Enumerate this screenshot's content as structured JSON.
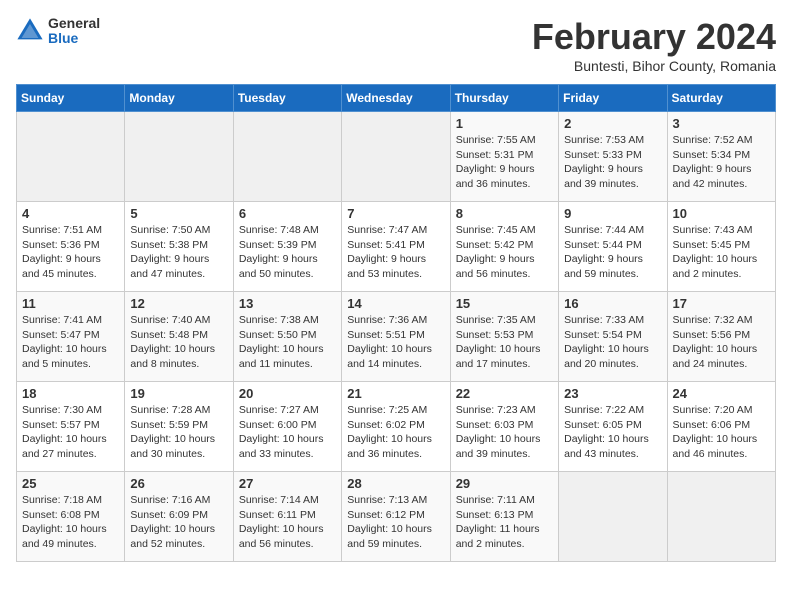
{
  "logo": {
    "general": "General",
    "blue": "Blue"
  },
  "title": {
    "month_year": "February 2024",
    "location": "Buntesti, Bihor County, Romania"
  },
  "headers": [
    "Sunday",
    "Monday",
    "Tuesday",
    "Wednesday",
    "Thursday",
    "Friday",
    "Saturday"
  ],
  "weeks": [
    [
      {
        "day": "",
        "content": ""
      },
      {
        "day": "",
        "content": ""
      },
      {
        "day": "",
        "content": ""
      },
      {
        "day": "",
        "content": ""
      },
      {
        "day": "1",
        "content": "Sunrise: 7:55 AM\nSunset: 5:31 PM\nDaylight: 9 hours and 36 minutes."
      },
      {
        "day": "2",
        "content": "Sunrise: 7:53 AM\nSunset: 5:33 PM\nDaylight: 9 hours and 39 minutes."
      },
      {
        "day": "3",
        "content": "Sunrise: 7:52 AM\nSunset: 5:34 PM\nDaylight: 9 hours and 42 minutes."
      }
    ],
    [
      {
        "day": "4",
        "content": "Sunrise: 7:51 AM\nSunset: 5:36 PM\nDaylight: 9 hours and 45 minutes."
      },
      {
        "day": "5",
        "content": "Sunrise: 7:50 AM\nSunset: 5:38 PM\nDaylight: 9 hours and 47 minutes."
      },
      {
        "day": "6",
        "content": "Sunrise: 7:48 AM\nSunset: 5:39 PM\nDaylight: 9 hours and 50 minutes."
      },
      {
        "day": "7",
        "content": "Sunrise: 7:47 AM\nSunset: 5:41 PM\nDaylight: 9 hours and 53 minutes."
      },
      {
        "day": "8",
        "content": "Sunrise: 7:45 AM\nSunset: 5:42 PM\nDaylight: 9 hours and 56 minutes."
      },
      {
        "day": "9",
        "content": "Sunrise: 7:44 AM\nSunset: 5:44 PM\nDaylight: 9 hours and 59 minutes."
      },
      {
        "day": "10",
        "content": "Sunrise: 7:43 AM\nSunset: 5:45 PM\nDaylight: 10 hours and 2 minutes."
      }
    ],
    [
      {
        "day": "11",
        "content": "Sunrise: 7:41 AM\nSunset: 5:47 PM\nDaylight: 10 hours and 5 minutes."
      },
      {
        "day": "12",
        "content": "Sunrise: 7:40 AM\nSunset: 5:48 PM\nDaylight: 10 hours and 8 minutes."
      },
      {
        "day": "13",
        "content": "Sunrise: 7:38 AM\nSunset: 5:50 PM\nDaylight: 10 hours and 11 minutes."
      },
      {
        "day": "14",
        "content": "Sunrise: 7:36 AM\nSunset: 5:51 PM\nDaylight: 10 hours and 14 minutes."
      },
      {
        "day": "15",
        "content": "Sunrise: 7:35 AM\nSunset: 5:53 PM\nDaylight: 10 hours and 17 minutes."
      },
      {
        "day": "16",
        "content": "Sunrise: 7:33 AM\nSunset: 5:54 PM\nDaylight: 10 hours and 20 minutes."
      },
      {
        "day": "17",
        "content": "Sunrise: 7:32 AM\nSunset: 5:56 PM\nDaylight: 10 hours and 24 minutes."
      }
    ],
    [
      {
        "day": "18",
        "content": "Sunrise: 7:30 AM\nSunset: 5:57 PM\nDaylight: 10 hours and 27 minutes."
      },
      {
        "day": "19",
        "content": "Sunrise: 7:28 AM\nSunset: 5:59 PM\nDaylight: 10 hours and 30 minutes."
      },
      {
        "day": "20",
        "content": "Sunrise: 7:27 AM\nSunset: 6:00 PM\nDaylight: 10 hours and 33 minutes."
      },
      {
        "day": "21",
        "content": "Sunrise: 7:25 AM\nSunset: 6:02 PM\nDaylight: 10 hours and 36 minutes."
      },
      {
        "day": "22",
        "content": "Sunrise: 7:23 AM\nSunset: 6:03 PM\nDaylight: 10 hours and 39 minutes."
      },
      {
        "day": "23",
        "content": "Sunrise: 7:22 AM\nSunset: 6:05 PM\nDaylight: 10 hours and 43 minutes."
      },
      {
        "day": "24",
        "content": "Sunrise: 7:20 AM\nSunset: 6:06 PM\nDaylight: 10 hours and 46 minutes."
      }
    ],
    [
      {
        "day": "25",
        "content": "Sunrise: 7:18 AM\nSunset: 6:08 PM\nDaylight: 10 hours and 49 minutes."
      },
      {
        "day": "26",
        "content": "Sunrise: 7:16 AM\nSunset: 6:09 PM\nDaylight: 10 hours and 52 minutes."
      },
      {
        "day": "27",
        "content": "Sunrise: 7:14 AM\nSunset: 6:11 PM\nDaylight: 10 hours and 56 minutes."
      },
      {
        "day": "28",
        "content": "Sunrise: 7:13 AM\nSunset: 6:12 PM\nDaylight: 10 hours and 59 minutes."
      },
      {
        "day": "29",
        "content": "Sunrise: 7:11 AM\nSunset: 6:13 PM\nDaylight: 11 hours and 2 minutes."
      },
      {
        "day": "",
        "content": ""
      },
      {
        "day": "",
        "content": ""
      }
    ]
  ]
}
